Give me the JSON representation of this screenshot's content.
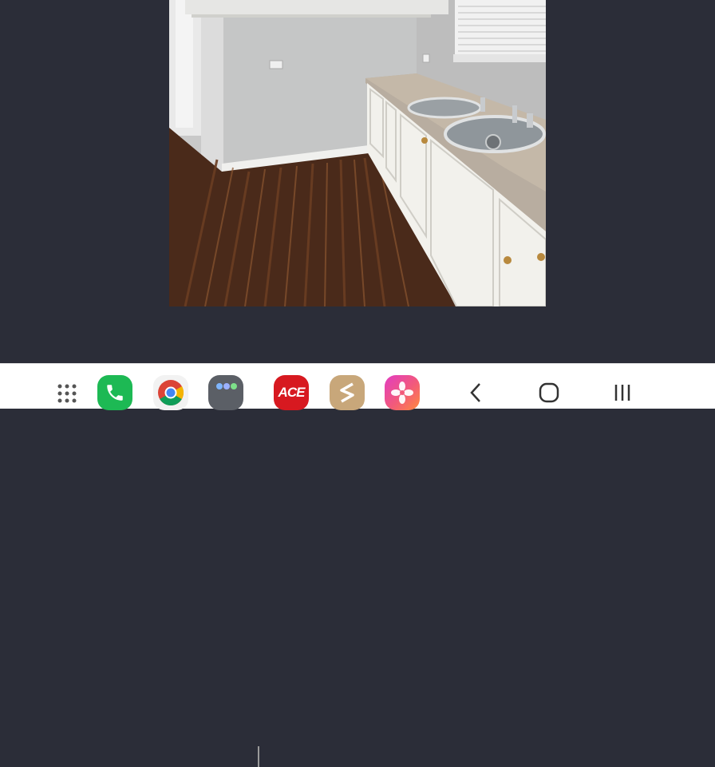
{
  "viewer": {
    "photo_subject": "kitchen-photo"
  },
  "taskbar": {
    "apps": [
      {
        "name": "apps-grid-icon"
      },
      {
        "name": "phone-app",
        "color": "#1db954"
      },
      {
        "name": "chrome-app"
      },
      {
        "name": "app-folder"
      },
      {
        "name": "ace-app",
        "label": "ACE",
        "color": "#d71920"
      },
      {
        "name": "s-app",
        "color": "#c8a77a"
      },
      {
        "name": "gallery-app"
      }
    ],
    "nav": {
      "back": "back-icon",
      "home": "home-icon",
      "recents": "recents-icon"
    }
  }
}
